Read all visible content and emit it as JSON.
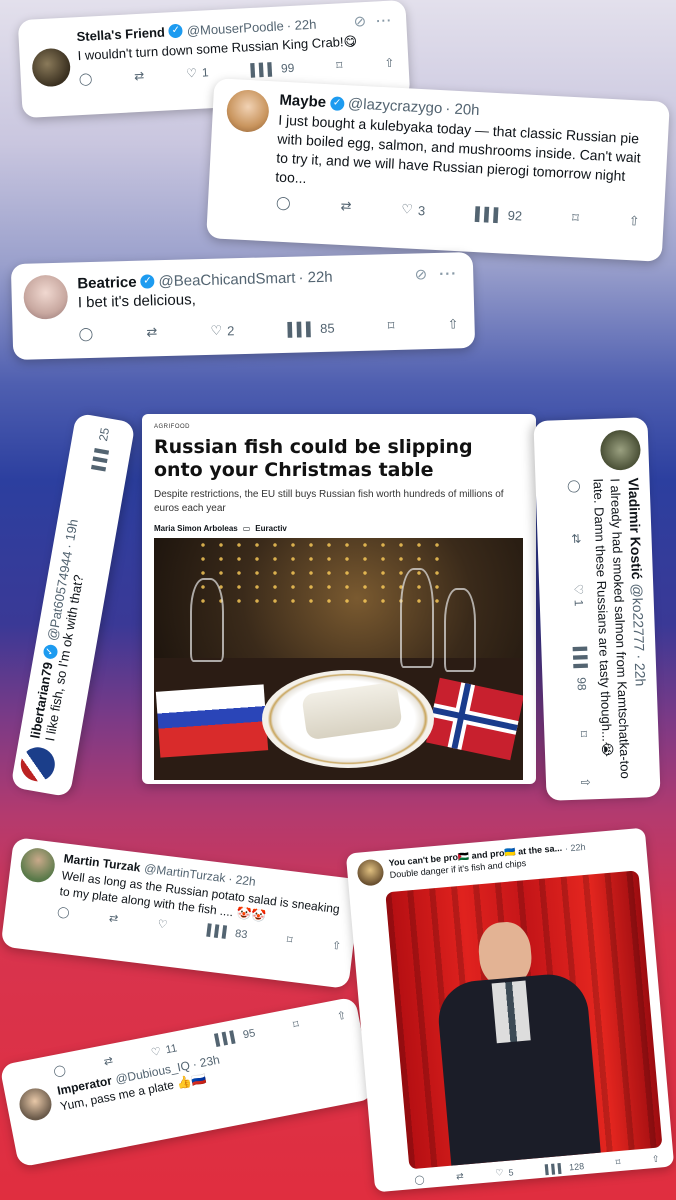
{
  "tweets": {
    "stella": {
      "name": "Stella's Friend",
      "handle": "@MouserPoodle",
      "time": "· 22h",
      "text": "I wouldn't turn down some Russian King Crab!😋",
      "likes": "1",
      "views": "99"
    },
    "maybe": {
      "name": "Maybe",
      "handle": "@lazycrazygo",
      "time": "· 20h",
      "text": "I just bought a kulebyaka today — that classic Russian pie with boiled egg, salmon, and mushrooms inside. Can't wait to try it, and we will have Russian pierogi tomorrow night too...",
      "likes": "3",
      "views": "92"
    },
    "beatrice": {
      "name": "Beatrice",
      "handle": "@BeaChicandSmart",
      "time": "· 22h",
      "text": "I bet it's delicious,",
      "likes": "2",
      "views": "85"
    },
    "libertarian": {
      "name": "libertarian79",
      "handle": "@Pat60574944",
      "time": "· 19h",
      "text": "I like fish, so I'm ok with that?",
      "views": "25"
    },
    "vladimir": {
      "name": "Vladimir Kostić",
      "handle": "@ko22777",
      "time": "· 22h",
      "text": "I already had smoked salmon from Kamtschatka-too late. Damn these Russians are tasty though...😭",
      "likes": "1",
      "views": "98"
    },
    "martin": {
      "name": "Martin Turzak",
      "handle": "@MartinTurzak",
      "time": "· 22h",
      "text": "Well as long as the Russian potato salad is sneaking to my plate along with the fish .... 🤡🤡",
      "views": "83"
    },
    "imperator": {
      "name": "Imperator",
      "handle": "@Dubious_IQ",
      "time": "· 23h",
      "text": "Yum, pass me a plate 👍🇷🇺",
      "likes": "11",
      "views": "95"
    },
    "cantbe": {
      "name": "You can't be pro🇵🇸 and pro🇺🇦 at the sa...",
      "time": "· 22h",
      "text": "Double danger if it's fish and chips",
      "likes": "5",
      "views": "128"
    }
  },
  "article": {
    "kicker": "AGRIFOOD",
    "title": "Russian fish could be slipping onto your Christmas table",
    "subtitle": "Despite restrictions, the EU still buys Russian fish worth hundreds of millions of euros each year",
    "author": "Maria Simon Arboleas",
    "outlet": "Euractiv"
  }
}
